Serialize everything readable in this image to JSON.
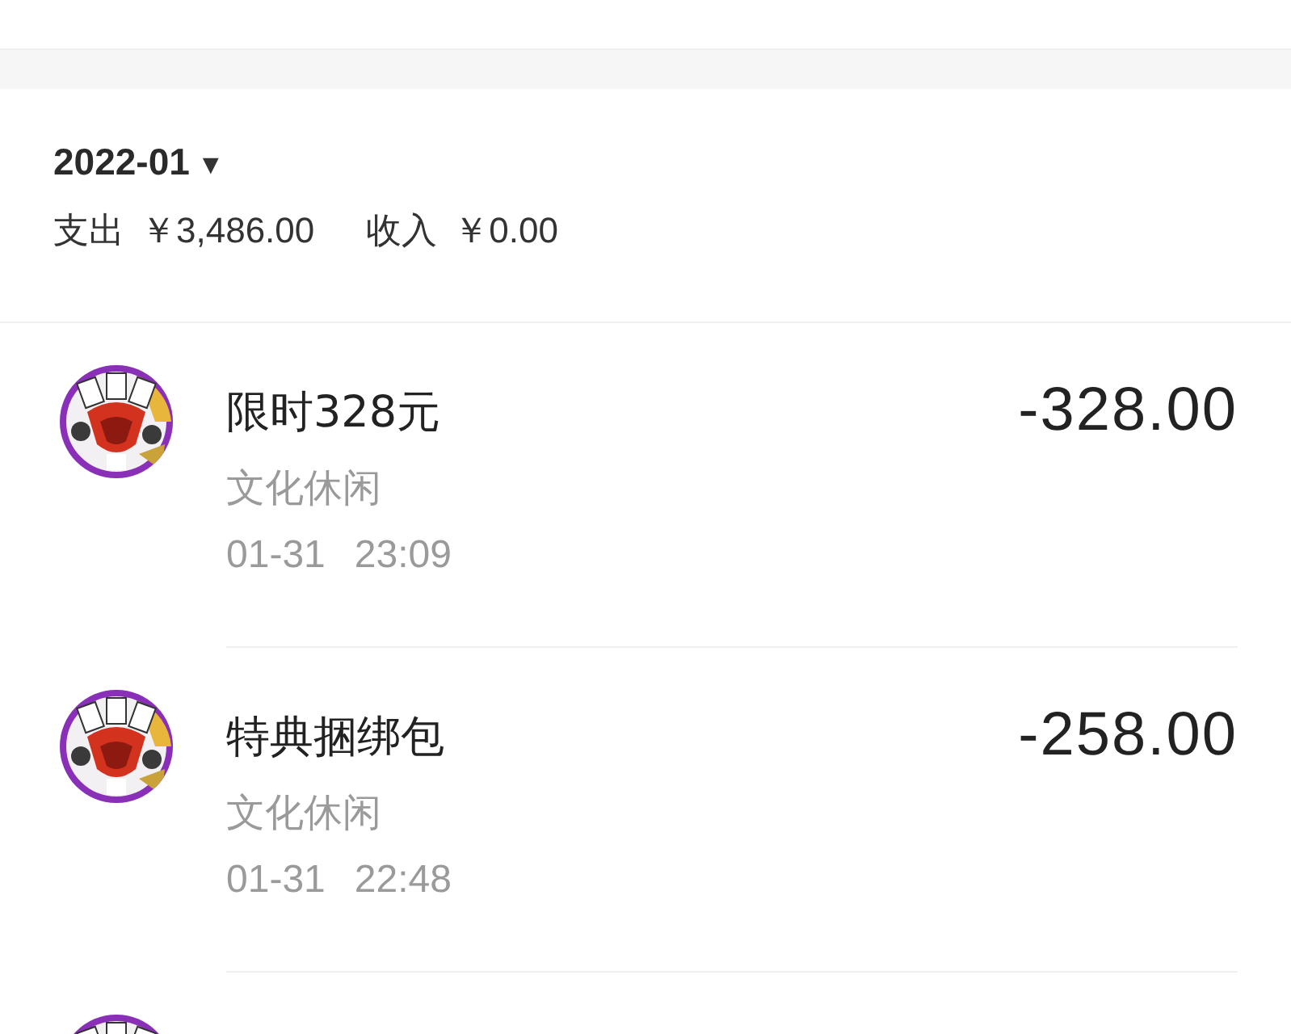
{
  "month": {
    "label": "2022-01",
    "dropdown": "▾"
  },
  "summary": {
    "expense_label": "支出",
    "expense": "￥3,486.00",
    "income_label": "收入",
    "income": "￥0.00"
  },
  "transactions": [
    {
      "title": "限时328元",
      "category": "文化休闲",
      "date": "01-31",
      "time": "23:09",
      "amount": "-328.00"
    },
    {
      "title": "特典捆绑包",
      "category": "文化休闲",
      "date": "01-31",
      "time": "22:48",
      "amount": "-258.00"
    }
  ]
}
